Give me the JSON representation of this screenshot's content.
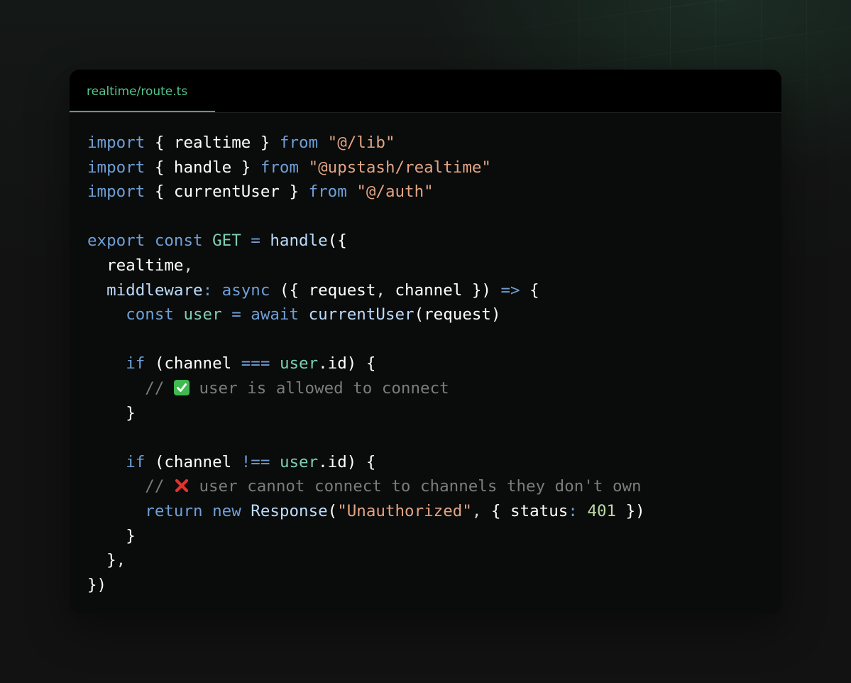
{
  "editor": {
    "tab_label": "realtime/route.ts"
  },
  "colors": {
    "background": "#121212",
    "card": "#0a0b0b",
    "tab_accent": "#54c48e",
    "keyword": "#6e9fd6",
    "string": "#e1a584",
    "function": "#bcdcfb",
    "variable": "#7ecfb2",
    "number": "#bcd9a6",
    "comment": "#7c7c7c"
  },
  "code": {
    "l1": {
      "kw1": "import",
      "mid": " { realtime } ",
      "kw2": "from",
      "sp": " ",
      "str": "\"@/lib\""
    },
    "l2": {
      "kw1": "import",
      "mid": " { handle } ",
      "kw2": "from",
      "sp": " ",
      "str": "\"@upstash/realtime\""
    },
    "l3": {
      "kw1": "import",
      "mid": " { currentUser } ",
      "kw2": "from",
      "sp": " ",
      "str": "\"@/auth\""
    },
    "l5": {
      "kw1": "export",
      "kw2": "const",
      "var": "GET",
      "op": "=",
      "fn": "handle",
      "tail": "({"
    },
    "l6": {
      "text": "realtime",
      "punct": ","
    },
    "l7": {
      "prop": "middleware",
      "colon": ":",
      "kw": "async",
      "params": " ({ request",
      "comma": ",",
      "params2": " channel }) ",
      "arrow": "=>",
      "brace": " {"
    },
    "l8": {
      "kw": "const",
      "var": "user",
      "op": "=",
      "kw2": "await",
      "fn": "currentUser",
      "tail": "(request)"
    },
    "l10": {
      "kw": "if",
      "a": " (channel ",
      "op": "===",
      "var": "user",
      "tail": ".id) {"
    },
    "l11": {
      "slashes": "//",
      "emoji": "check-mark-emoji",
      "comment": " user is allowed to connect"
    },
    "l12": {
      "text": "}"
    },
    "l14": {
      "kw": "if",
      "a": " (channel ",
      "op": "!==",
      "var": "user",
      "tail": ".id) {"
    },
    "l15": {
      "slashes": "//",
      "emoji": "cross-mark-emoji",
      "comment": " user cannot connect to channels they don't own"
    },
    "l16": {
      "kw": "return",
      "kw2": "new",
      "fn": "Response",
      "open": "(",
      "str": "\"Unauthorized\"",
      "comma": ",",
      "mid": " { status",
      "colon": ":",
      "num": "401",
      "tail": " })"
    },
    "l17": {
      "text": "}"
    },
    "l18": {
      "text": "}",
      "punct": ","
    },
    "l19": {
      "text": "})"
    }
  }
}
